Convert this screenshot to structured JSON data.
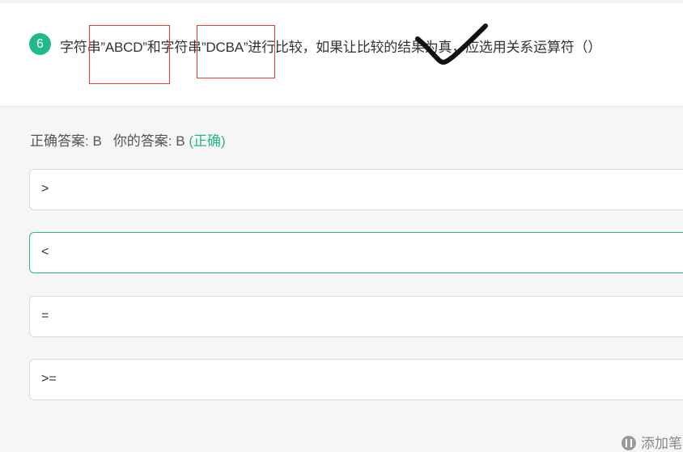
{
  "question": {
    "number": "6",
    "text": "字符串”ABCD”和字符串”DCBA”进行比较，如果让比较的结果为真，应选用关系运算符（）"
  },
  "answer_line": {
    "correct_label": "正确答案: B",
    "your_label": "你的答案: B",
    "result": "(正确)"
  },
  "options": [
    {
      "text": ">",
      "selected": false
    },
    {
      "text": "<",
      "selected": true
    },
    {
      "text": "=",
      "selected": false
    },
    {
      "text": ">=",
      "selected": false
    }
  ],
  "footer": {
    "add_note_label": "添加笔"
  },
  "colors": {
    "accent": "#20b98a",
    "highlight_box": "#e83a3a",
    "check_stroke": "#111111"
  }
}
